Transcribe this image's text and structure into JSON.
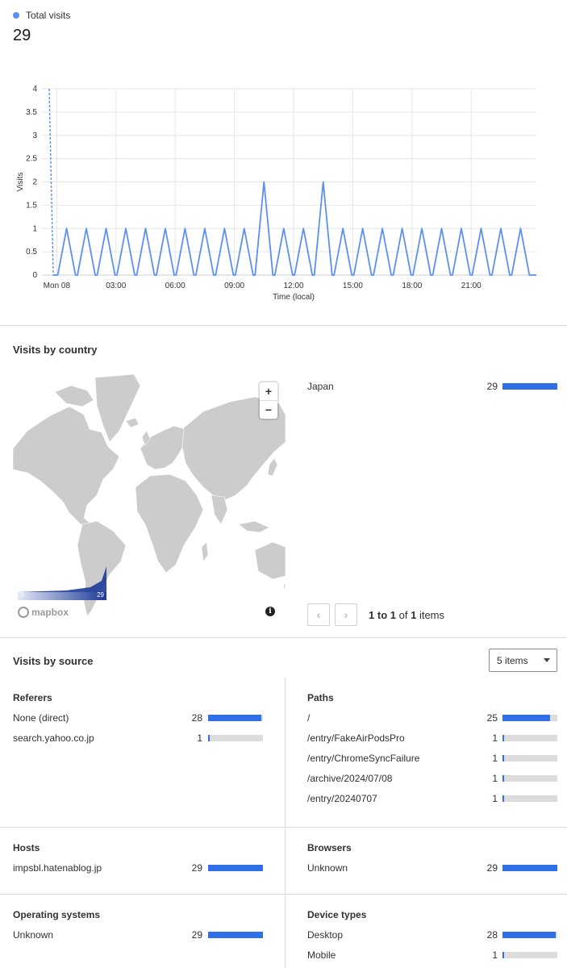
{
  "summary": {
    "legend_label": "Total visits",
    "total": "29",
    "series_color": "#5b8ff5"
  },
  "chart_data": {
    "type": "line",
    "ylabel": "Visits",
    "xlabel": "Time (local)",
    "ylim": [
      0,
      4
    ],
    "yticks": [
      "0",
      "0.5",
      "1",
      "1.5",
      "2",
      "2.5",
      "3",
      "3.5",
      "4"
    ],
    "xtick_labels": [
      "Mon 08",
      "03:00",
      "06:00",
      "09:00",
      "12:00",
      "15:00",
      "18:00",
      "21:00"
    ],
    "xtick_hours": [
      0,
      3,
      6,
      9,
      12,
      15,
      18,
      21
    ],
    "x_hours": [
      0.5,
      1.5,
      2.5,
      3.5,
      4.5,
      5.5,
      6.5,
      7.5,
      8.5,
      9.5,
      10.5,
      11.5,
      12.5,
      13.5,
      14.5,
      15.5,
      16.5,
      17.5,
      18.5,
      19.5,
      20.5,
      21.5,
      22.5,
      23.5
    ],
    "y": [
      1,
      1,
      1,
      1,
      1,
      1,
      1,
      1,
      1,
      1,
      2,
      1,
      1,
      2,
      1,
      1,
      1,
      1,
      1,
      1,
      1,
      1,
      1,
      1
    ],
    "x_range_hours": [
      -0.75,
      24.3
    ],
    "grid": true
  },
  "country": {
    "title": "Visits by country",
    "zoom_in": "+",
    "zoom_out": "−",
    "scale_min": "0",
    "scale_max": "29",
    "mapbox": "mapbox",
    "info": "i",
    "rows": [
      {
        "label": "Japan",
        "count": "29",
        "fraction": 1.0
      }
    ],
    "pager": {
      "prev": "‹",
      "next": "›",
      "from": "1",
      "to": "1",
      "total": "1",
      "to_word": "to",
      "of_word": "of",
      "items_word": "items"
    }
  },
  "source": {
    "title": "Visits by source",
    "select_value": "5 items",
    "referers": {
      "title": "Referers",
      "rows": [
        {
          "label": "None (direct)",
          "count": "28",
          "fraction": 0.966
        },
        {
          "label": "search.yahoo.co.jp",
          "count": "1",
          "fraction": 0.034
        }
      ]
    },
    "paths": {
      "title": "Paths",
      "rows": [
        {
          "label": "/",
          "count": "25",
          "fraction": 0.862
        },
        {
          "label": "/entry/FakeAirPodsPro",
          "count": "1",
          "fraction": 0.034
        },
        {
          "label": "/entry/ChromeSyncFailure",
          "count": "1",
          "fraction": 0.034
        },
        {
          "label": "/archive/2024/07/08",
          "count": "1",
          "fraction": 0.034
        },
        {
          "label": "/entry/20240707",
          "count": "1",
          "fraction": 0.034
        }
      ]
    },
    "hosts": {
      "title": "Hosts",
      "rows": [
        {
          "label": "impsbl.hatenablog.jp",
          "count": "29",
          "fraction": 1.0
        }
      ]
    },
    "browsers": {
      "title": "Browsers",
      "rows": [
        {
          "label": "Unknown",
          "count": "29",
          "fraction": 1.0
        }
      ]
    },
    "os": {
      "title": "Operating systems",
      "rows": [
        {
          "label": "Unknown",
          "count": "29",
          "fraction": 1.0
        }
      ]
    },
    "devices": {
      "title": "Device types",
      "rows": [
        {
          "label": "Desktop",
          "count": "28",
          "fraction": 0.966
        },
        {
          "label": "Mobile",
          "count": "1",
          "fraction": 0.034
        }
      ]
    }
  }
}
